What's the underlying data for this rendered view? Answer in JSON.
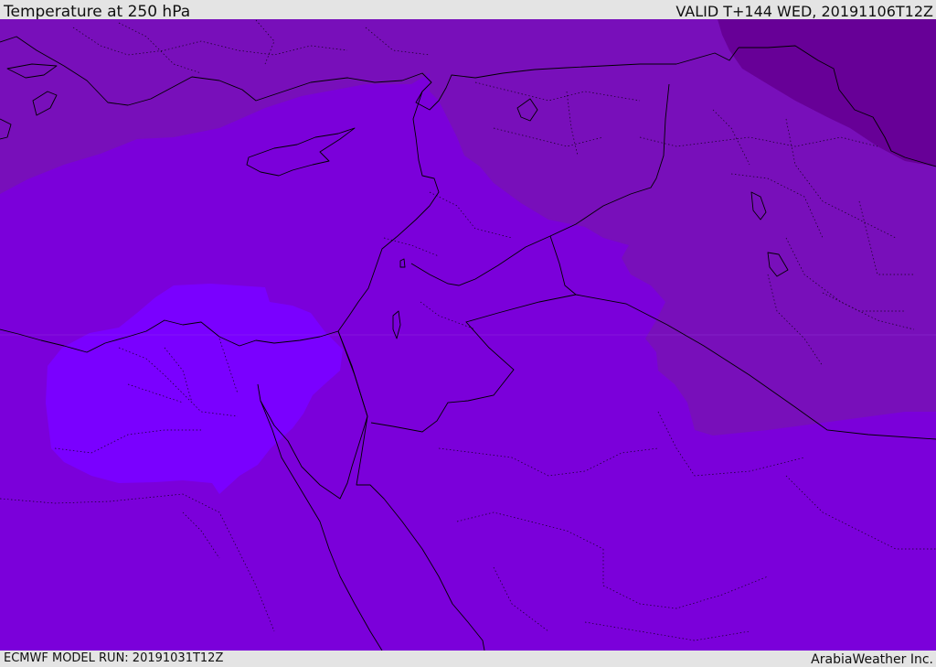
{
  "header": {
    "title": "Temperature at 250 hPa",
    "valid": "VALID T+144 WED, 20191106T12Z"
  },
  "footer": {
    "model_run": "ECMWF MODEL RUN: 20191031T12Z",
    "credit": "ArabiaWeather Inc."
  },
  "map": {
    "region": "Eastern Mediterranean / Middle East",
    "colors": {
      "warmest_zone": "#7a00ff",
      "middle_zone": "#7b00da",
      "cool_zone": "#780fba",
      "coldest_zone": "#670097",
      "borders": "#000000"
    }
  }
}
